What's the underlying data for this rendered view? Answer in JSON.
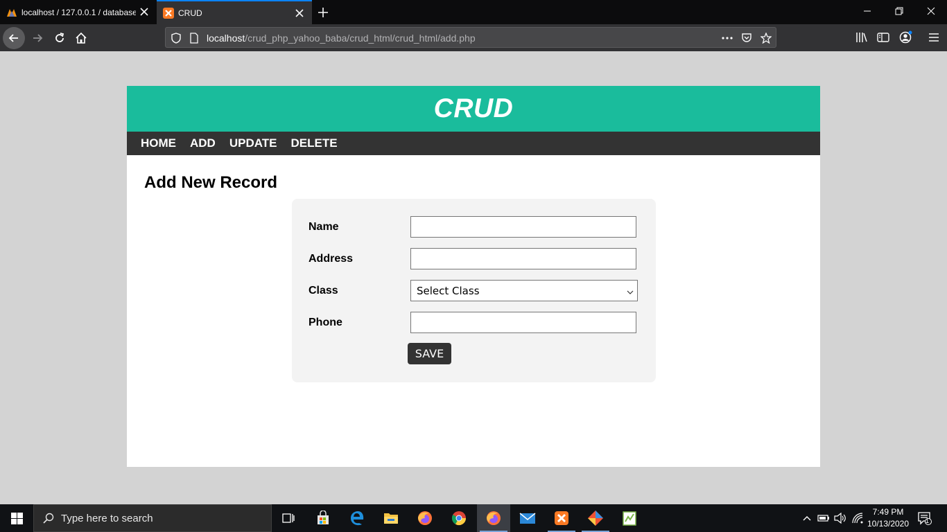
{
  "browser": {
    "tabs": [
      {
        "title": "localhost / 127.0.0.1 / database",
        "icon": "phpmyadmin-icon"
      },
      {
        "title": "CRUD",
        "icon": "xampp-icon"
      }
    ],
    "url_host": "localhost",
    "url_path": "/crud_php_yahoo_baba/crud_html/crud_html/add.php"
  },
  "page": {
    "header_title": "CRUD",
    "menu": [
      "HOME",
      "ADD",
      "UPDATE",
      "DELETE"
    ],
    "heading": "Add New Record",
    "form": {
      "name_label": "Name",
      "name_value": "",
      "address_label": "Address",
      "address_value": "",
      "class_label": "Class",
      "class_selected": "Select Class",
      "phone_label": "Phone",
      "phone_value": "",
      "save_label": "SAVE"
    }
  },
  "taskbar": {
    "search_placeholder": "Type here to search",
    "time": "7:49 PM",
    "date": "10/13/2020",
    "notification_count": "1"
  },
  "colors": {
    "header_bg": "#1abc9c",
    "menu_bg": "#333333",
    "accent_tab": "#0a84ff"
  }
}
